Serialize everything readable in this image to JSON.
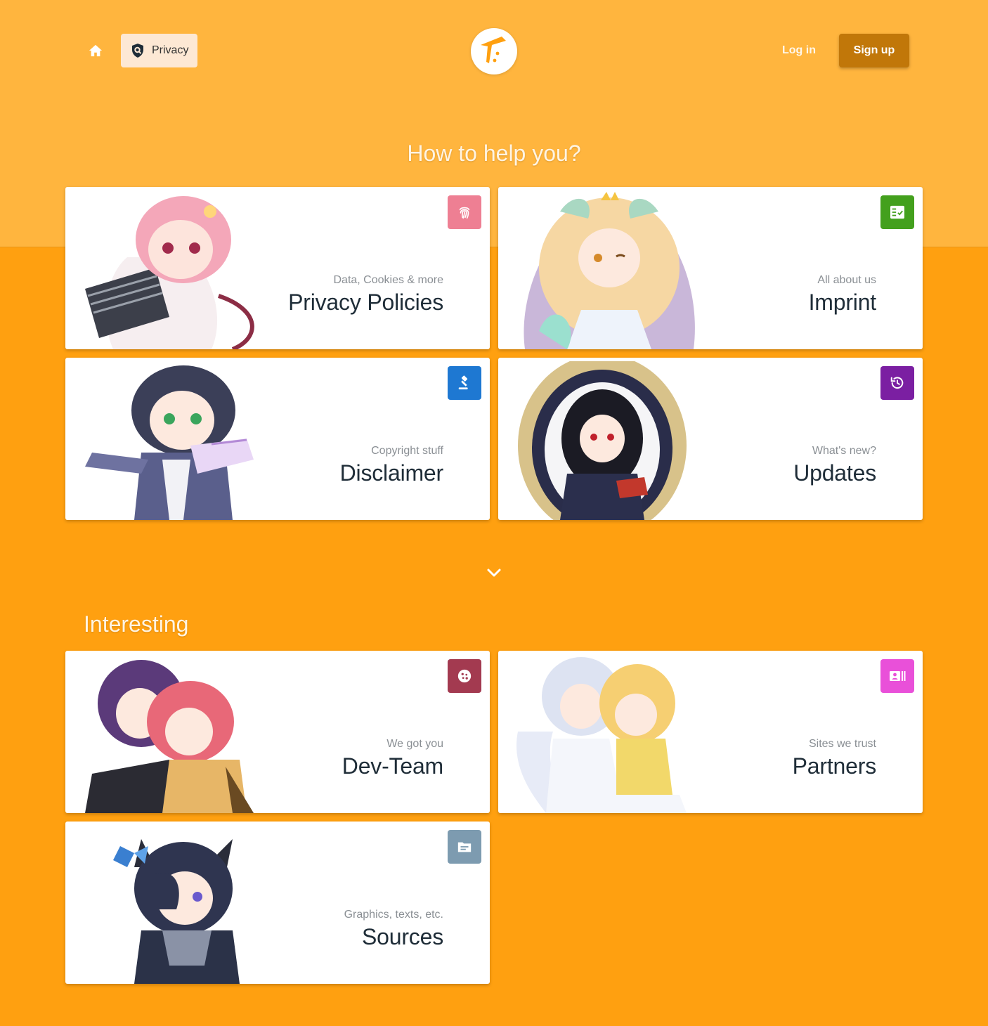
{
  "header": {
    "home_icon": "home-icon",
    "breadcrumb_label": "Privacy",
    "breadcrumb_icon": "shield-search-icon",
    "login_label": "Log in",
    "signup_label": "Sign up"
  },
  "sections": {
    "help_title": "How to help you?",
    "interesting_title": "Interesting"
  },
  "cards": [
    {
      "subtitle": "Data, Cookies & more",
      "title": "Privacy Policies",
      "icon": "fingerprint-icon",
      "color": "#ee7f93"
    },
    {
      "subtitle": "All about us",
      "title": "Imprint",
      "icon": "checklist-icon",
      "color": "#43a01d"
    },
    {
      "subtitle": "Copyright stuff",
      "title": "Disclaimer",
      "icon": "gavel-icon",
      "color": "#1e78d2"
    },
    {
      "subtitle": "What's new?",
      "title": "Updates",
      "icon": "history-icon",
      "color": "#7b1fa2"
    },
    {
      "subtitle": "We got you",
      "title": "Dev-Team",
      "icon": "cookie-icon",
      "color": "#a33a50"
    },
    {
      "subtitle": "Sites we trust",
      "title": "Partners",
      "icon": "contact-card-icon",
      "color": "#e950d9"
    },
    {
      "subtitle": "Graphics, texts, etc.",
      "title": "Sources",
      "icon": "folder-icon",
      "color": "#7d9bb0"
    }
  ],
  "colors": {
    "top_band": "#ffb53e",
    "background": "#ffa010",
    "signup_button": "#c17709"
  }
}
